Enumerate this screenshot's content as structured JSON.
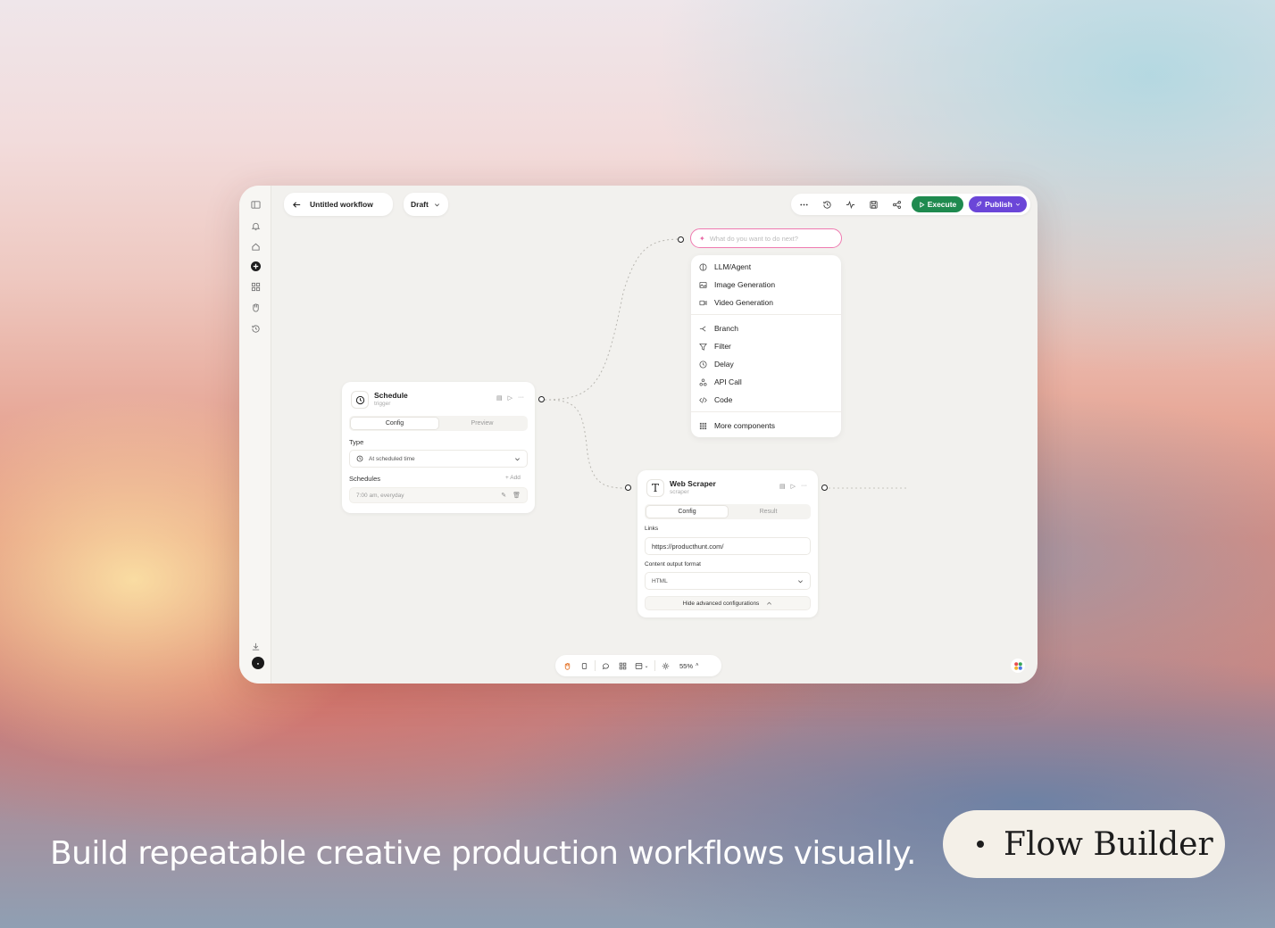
{
  "header": {
    "workflow_title": "Untitled workflow",
    "status": "Draft",
    "execute_label": "Execute",
    "publish_label": "Publish"
  },
  "schedule_node": {
    "title": "Schedule",
    "subtitle": "trigger",
    "tabs": [
      "Config",
      "Preview"
    ],
    "type_label": "Type",
    "type_value": "At scheduled time",
    "schedules_label": "Schedules",
    "add_label": "+ Add",
    "schedule_item": "7:00 am, everyday"
  },
  "scraper_node": {
    "title": "Web Scraper",
    "subtitle": "scraper",
    "tabs": [
      "Config",
      "Result"
    ],
    "links_label": "Links",
    "links_value": "https://producthunt.com/",
    "format_label": "Content output format",
    "format_value": "HTML",
    "advanced_label": "Hide advanced configurations"
  },
  "prompt": {
    "placeholder": "What do you want to do next?"
  },
  "menu": {
    "items": [
      {
        "label": "LLM/Agent",
        "icon": "agent-icon"
      },
      {
        "label": "Image Generation",
        "icon": "image-icon"
      },
      {
        "label": "Video Generation",
        "icon": "video-icon"
      },
      {
        "label": "Branch",
        "icon": "branch-icon"
      },
      {
        "label": "Filter",
        "icon": "filter-icon"
      },
      {
        "label": "Delay",
        "icon": "clock-icon"
      },
      {
        "label": "API Call",
        "icon": "api-icon"
      },
      {
        "label": "Code",
        "icon": "code-icon"
      },
      {
        "label": "More components",
        "icon": "grid-icon"
      }
    ]
  },
  "bottom_bar": {
    "zoom": "55%"
  },
  "footer": {
    "tagline": "Build repeatable creative production workflows visually.",
    "badge": "Flow Builder"
  },
  "colors": {
    "execute": "#1f8a4f",
    "publish": "#6b46d8",
    "prompt_border": "#ef7ab0"
  }
}
